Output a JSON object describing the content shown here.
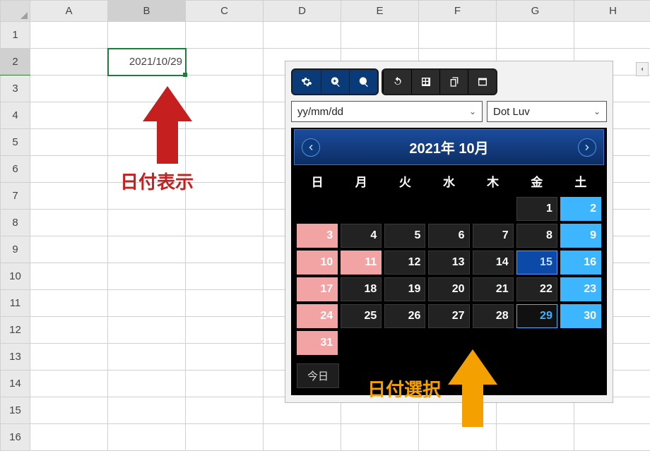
{
  "spreadsheet": {
    "columns": [
      "A",
      "B",
      "C",
      "D",
      "E",
      "F",
      "G",
      "H"
    ],
    "rows": [
      "1",
      "2",
      "3",
      "4",
      "5",
      "6",
      "7",
      "8",
      "9",
      "10",
      "11",
      "12",
      "13",
      "14",
      "15",
      "16"
    ],
    "selected_cell_value": "2021/10/29",
    "selected_col_index": 1,
    "selected_row_index": 1
  },
  "annotation_red": {
    "label": "日付表示"
  },
  "annotation_orange": {
    "label": "日付選択"
  },
  "toolbar": {
    "icons_blue": [
      "gear-icon",
      "zoom-in-icon",
      "zoom-out-icon"
    ],
    "icons_dark": [
      "refresh-icon",
      "grid-icon",
      "copy-icon",
      "window-icon"
    ]
  },
  "selects": {
    "format": "yy/mm/dd",
    "theme": "Dot Luv"
  },
  "calendar": {
    "title": "2021年 10月",
    "dow": [
      "日",
      "月",
      "火",
      "水",
      "木",
      "金",
      "土"
    ],
    "today_label": "今日",
    "cells": [
      {
        "n": "",
        "t": "empty"
      },
      {
        "n": "",
        "t": "empty"
      },
      {
        "n": "",
        "t": "empty"
      },
      {
        "n": "",
        "t": "empty"
      },
      {
        "n": "",
        "t": "empty"
      },
      {
        "n": "1",
        "t": ""
      },
      {
        "n": "2",
        "t": "sat"
      },
      {
        "n": "3",
        "t": "sun"
      },
      {
        "n": "4",
        "t": ""
      },
      {
        "n": "5",
        "t": ""
      },
      {
        "n": "6",
        "t": ""
      },
      {
        "n": "7",
        "t": ""
      },
      {
        "n": "8",
        "t": ""
      },
      {
        "n": "9",
        "t": "sat"
      },
      {
        "n": "10",
        "t": "sun"
      },
      {
        "n": "11",
        "t": "hol"
      },
      {
        "n": "12",
        "t": ""
      },
      {
        "n": "13",
        "t": ""
      },
      {
        "n": "14",
        "t": ""
      },
      {
        "n": "15",
        "t": "hi"
      },
      {
        "n": "16",
        "t": "sat"
      },
      {
        "n": "17",
        "t": "sun"
      },
      {
        "n": "18",
        "t": ""
      },
      {
        "n": "19",
        "t": ""
      },
      {
        "n": "20",
        "t": ""
      },
      {
        "n": "21",
        "t": ""
      },
      {
        "n": "22",
        "t": ""
      },
      {
        "n": "23",
        "t": "sat"
      },
      {
        "n": "24",
        "t": "sun"
      },
      {
        "n": "25",
        "t": ""
      },
      {
        "n": "26",
        "t": ""
      },
      {
        "n": "27",
        "t": ""
      },
      {
        "n": "28",
        "t": ""
      },
      {
        "n": "29",
        "t": "sel"
      },
      {
        "n": "30",
        "t": "sat"
      },
      {
        "n": "31",
        "t": "sun"
      },
      {
        "n": "",
        "t": "empty"
      },
      {
        "n": "",
        "t": "empty"
      },
      {
        "n": "",
        "t": "empty"
      },
      {
        "n": "",
        "t": "empty"
      },
      {
        "n": "",
        "t": "empty"
      },
      {
        "n": "",
        "t": "empty"
      }
    ]
  }
}
